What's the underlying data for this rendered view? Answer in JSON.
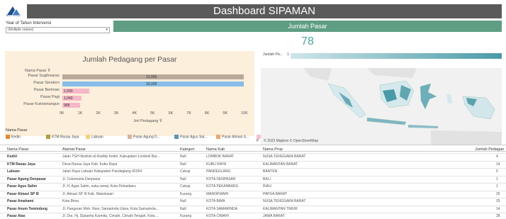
{
  "header": {
    "logo_text": "BAPPENAS",
    "title": "Dashboard SIPAMAN"
  },
  "filter": {
    "label": "Year of Tahun Intervensi",
    "value": "(Multiple values)"
  },
  "kpi": {
    "label": "Jumlah Pasar",
    "value": "78"
  },
  "bar_card": {
    "title": "Jumlah Pedagang per Pasar",
    "y_title": "Nama Pasar",
    "x_title": "Jml Pedagang"
  },
  "map": {
    "legend_label": "Jumlah Pa...",
    "legend_min": "1",
    "credit": "© 2023 Mapbox © OpenStreetMap"
  },
  "legend": {
    "title": "Nama Pasar",
    "items": [
      {
        "label": "Kediri",
        "color": "#e58a2e"
      },
      {
        "label": "KTM Rasau Jaya",
        "color": "#b89a3a"
      },
      {
        "label": "Labuan",
        "color": "#f3d27a"
      },
      {
        "label": "Pasar Agung D...",
        "color": "#d7b49e"
      },
      {
        "label": "Pasar Agus Sal...",
        "color": "#5b93b5"
      },
      {
        "label": "Pasar Almasi S...",
        "color": "#e9a86a"
      },
      {
        "label": "P",
        "color": "#f6c0cf"
      }
    ]
  },
  "table": {
    "headers": [
      "Nama Pasar",
      "Alamat Pasar",
      "Kategori",
      "Nama Kab",
      "Nama Prop",
      "Jumlah Pedagan"
    ],
    "rows": [
      [
        "Kediri",
        "Jalan TGH Ibrahim al khalidy Kediri, Kabupaten Lombok Bar...",
        "Null",
        "LOMBOK BARAT",
        "NUSA TENGGARA BARAT",
        "4"
      ],
      [
        "KTM Rasau Jaya",
        "Desa Rasau Jaya Kab. Kubu Raya",
        "Null",
        "KUBU RAYA",
        "KALIMANTAN BARAT",
        "14"
      ],
      [
        "Labuan",
        "Jalan Raya Labuan Kabupaten Pandeglang 42264",
        "Cukup",
        "PANDEGLANG",
        "BANTEN",
        "5"
      ],
      [
        "Pasar Agung Denpasar",
        "Jl. Cekomaria Denpasar",
        "Null",
        "KOTA DENPASAR",
        "BALI",
        "1"
      ],
      [
        "Pasar Agus Salim",
        "Jl. H. Agus Salim, suka ramai, Kota Pekanbaru",
        "Cukup",
        "KOTA PEKANBARU",
        "RIAU",
        "1"
      ],
      [
        "Pasar Almasi SP III",
        "Jl. Almasi SP III Kab. Manokwari",
        "Kurang",
        "MANOKWARI",
        "PAPUA BARAT",
        "25"
      ],
      [
        "Pasar Amahami",
        "Kota Bima",
        "Null",
        "KOTA BIMA",
        "NUSA TENGGARA BARAT",
        "25"
      ],
      [
        "Pasar Anum Temindung",
        "Jl. Pangeran Moh. Noor, Samarinda Utara, Kota Samarinda...",
        "Null",
        "KOTA SAMARINDA",
        "KALIMANTAN TIMUR",
        "14"
      ],
      [
        "Pasar Atas",
        "Jl. Dra. Hj. Djulaeha Karmita, Cimahi, Cimahi Tengah, Kota ...",
        "Kurang",
        "KOTA CIMAHI",
        "JAWA BARAT",
        "28"
      ]
    ]
  },
  "chart_data": {
    "type": "bar",
    "orientation": "horizontal",
    "title": "Jumlah Pedagang per Pasar",
    "xlabel": "Jml Pedagang",
    "ylabel": "Nama Pasar",
    "categories": [
      "Pasar Sugihwaras",
      "Pasar Sendoro",
      "Pasar Beriman",
      "Pasar Pagi",
      "Pasar Kutowinangun"
    ],
    "values": [
      10000,
      10000,
      1500,
      1040,
      968
    ],
    "labels": [
      "10,000",
      "10,000",
      "1,500",
      "1,040",
      "968"
    ],
    "colors": [
      "#b8a99a",
      "#87bde6",
      "#f6b7c8",
      "#f6b7c8",
      "#f6b7c8"
    ],
    "xlim": [
      0,
      10000
    ],
    "ticks": [
      "0K",
      "1K",
      "2K",
      "3K",
      "4K",
      "5K",
      "6K",
      "7K",
      "8K",
      "9K",
      "10K"
    ]
  }
}
